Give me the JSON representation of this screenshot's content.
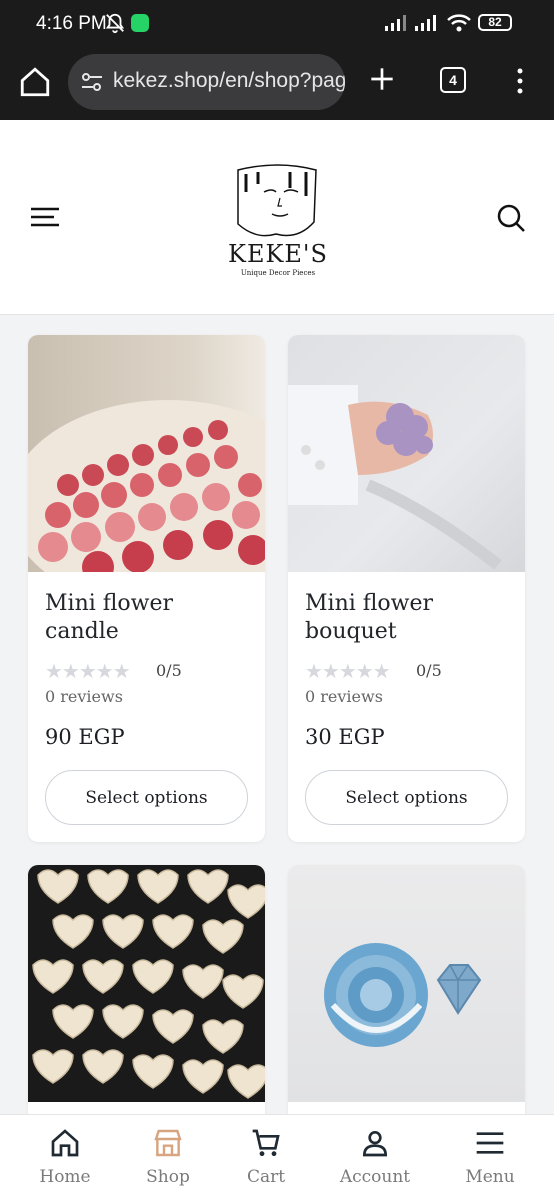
{
  "status_bar": {
    "time": "4:16 PM",
    "battery": "82"
  },
  "browser": {
    "url": "kekez.shop/en/shop?page",
    "tab_count": "4"
  },
  "site": {
    "brand": "KEKE'S",
    "tagline": "Unique Decor Pieces"
  },
  "products": [
    {
      "name": "Mini flower candle",
      "stars": "★★★★★",
      "rating": "0/5",
      "reviews": "0 reviews",
      "price": "90 EGP",
      "button": "Select options",
      "image": "red-pink-rose-candles"
    },
    {
      "name": "Mini flower bouquet",
      "stars": "★★★★★",
      "rating": "0/5",
      "reviews": "0 reviews",
      "price": "30 EGP",
      "button": "Select options",
      "image": "lilac-flower-candle-in-hand"
    },
    {
      "image": "cream-heart-rose-candles"
    },
    {
      "image": "blue-peony-and-heart-candles"
    }
  ],
  "bottom_nav": [
    {
      "label": "Home",
      "icon": "home-icon"
    },
    {
      "label": "Shop",
      "icon": "shop-icon",
      "active": true
    },
    {
      "label": "Cart",
      "icon": "cart-icon"
    },
    {
      "label": "Account",
      "icon": "account-icon"
    },
    {
      "label": "Menu",
      "icon": "menu-icon"
    }
  ],
  "colors": {
    "accent": "#d8a47f",
    "text": "#22252a",
    "muted": "#7a7a7a",
    "star": "#d6d8dd"
  }
}
